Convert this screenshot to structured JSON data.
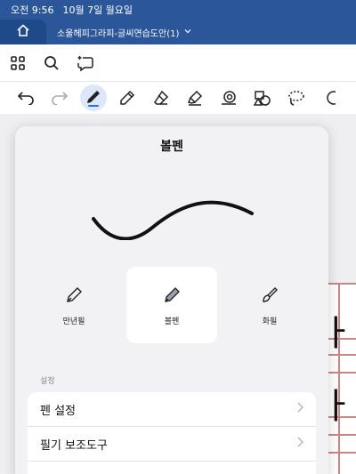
{
  "status": {
    "time": "오전 9:56",
    "date": "10월 7일 월요일"
  },
  "title_bar": {
    "document_title": "소울헤피그라피-글씨연습도안(1)"
  },
  "background_doc": {
    "glyph1": "ㅏ",
    "glyph2": "ㅏ"
  },
  "panel": {
    "title": "볼펜",
    "pens": [
      {
        "label": "만년필",
        "active": false
      },
      {
        "label": "볼펜",
        "active": true
      },
      {
        "label": "화필",
        "active": false
      }
    ],
    "settings_section_label": "설정",
    "settings": [
      {
        "label": "펜 설정"
      },
      {
        "label": "필기 보조도구"
      },
      {
        "label": ""
      }
    ]
  },
  "colors": {
    "brand": "#2b579a",
    "selected_tool_bg": "#dce8fa",
    "stroke": "#111111"
  }
}
